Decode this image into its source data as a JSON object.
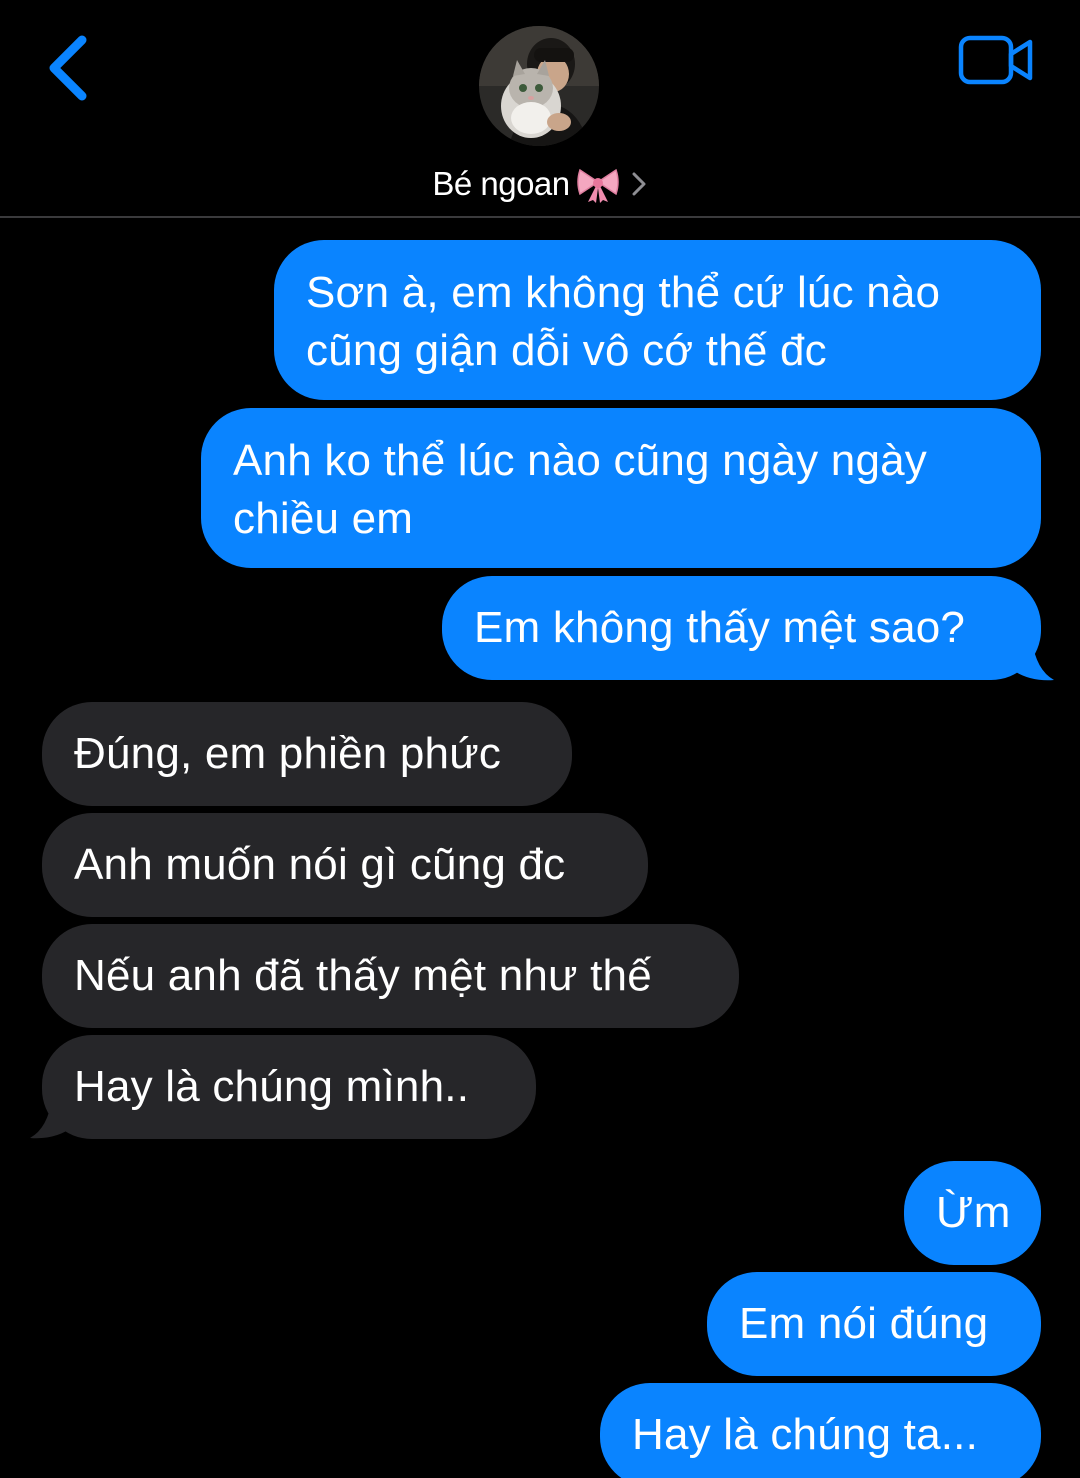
{
  "header": {
    "contact_name": "Bé ngoan",
    "icons": {
      "back": "chevron-left-icon",
      "video": "video-camera-icon",
      "name_emoji": "ribbon-bow-icon",
      "name_chevron": "chevron-right-icon"
    }
  },
  "colors": {
    "background": "#000000",
    "sent_bubble": "#0a84ff",
    "received_bubble": "#262629",
    "accent": "#0a84ff",
    "divider": "#3a3a3c"
  },
  "messages": [
    {
      "direction": "sent",
      "lines": [
        "Sơn à, em không thể cứ lúc nào",
        "cũng giận dỗi vô cớ thế đc"
      ]
    },
    {
      "direction": "sent",
      "lines": [
        "Anh ko thể lúc nào cũng ngày ngày",
        "chiều em"
      ]
    },
    {
      "direction": "sent",
      "lines": [
        "Em không thấy mệt sao?"
      ]
    },
    {
      "direction": "received",
      "lines": [
        "Đúng, em phiền phức"
      ]
    },
    {
      "direction": "received",
      "lines": [
        "Anh muốn nói gì cũng đc"
      ]
    },
    {
      "direction": "received",
      "lines": [
        "Nếu anh đã thấy mệt như thế"
      ]
    },
    {
      "direction": "received",
      "lines": [
        "Hay là chúng mình.."
      ]
    },
    {
      "direction": "sent",
      "lines": [
        "Ừm"
      ]
    },
    {
      "direction": "sent",
      "lines": [
        "Em nói đúng"
      ]
    },
    {
      "direction": "sent",
      "lines": [
        "Hay là chúng ta..."
      ]
    }
  ]
}
